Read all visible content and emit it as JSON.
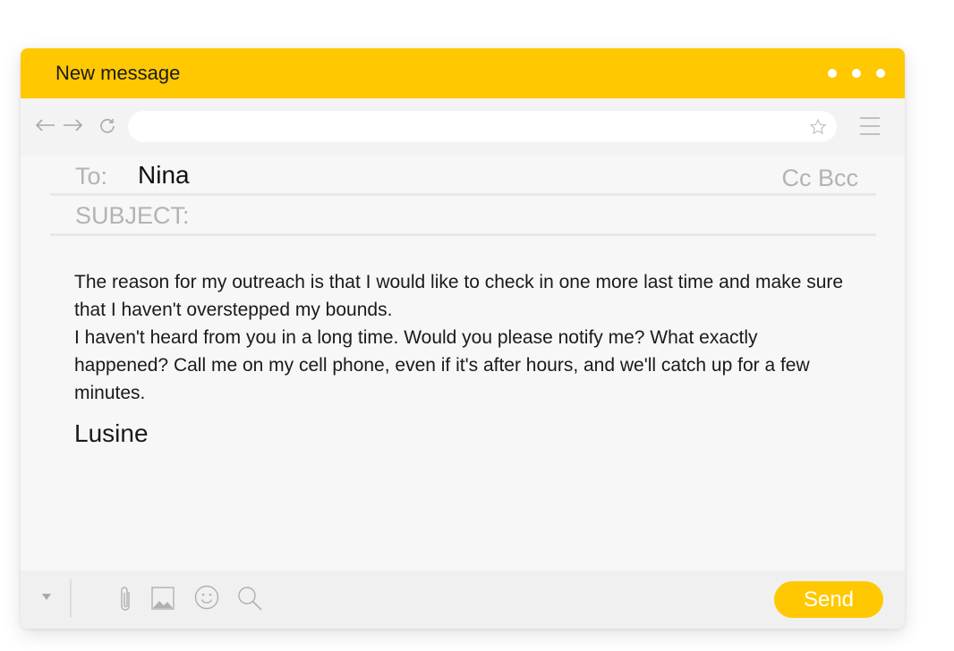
{
  "window": {
    "title": "New message"
  },
  "navigation": {
    "address_value": ""
  },
  "header_fields": {
    "to_label": "To:",
    "to_value": "Nina",
    "cc_bcc_label": "Cc Bcc",
    "subject_label": "SUBJECT:",
    "subject_value": ""
  },
  "body": {
    "paragraph_1": "The reason for my outreach is that I would like to check in one more last time and make sure that I haven't overstepped my bounds.",
    "paragraph_2": "I haven't heard from you in a long time. Would you please notify me? What exactly happened? Call me on my cell phone, even if it's after hours, and we'll catch up for a few minutes.",
    "signature": "Lusine"
  },
  "footer": {
    "send_label": "Send"
  },
  "icons": [
    "back-arrow-icon",
    "forward-arrow-icon",
    "refresh-icon",
    "star-icon",
    "menu-icon",
    "dots-icon",
    "dropdown-icon",
    "attachment-icon",
    "image-icon",
    "emoji-icon",
    "search-icon"
  ],
  "colors": {
    "accent": "#ffc800",
    "background": "#f7f7f7",
    "muted_text": "#b3b3b3",
    "text": "#1a1a1a"
  }
}
